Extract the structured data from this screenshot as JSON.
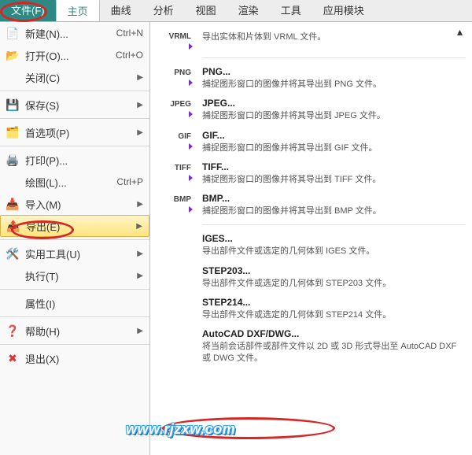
{
  "menubar": {
    "file": "文件(F)",
    "home": "主页",
    "curve": "曲线",
    "analyze": "分析",
    "view": "视图",
    "render": "渲染",
    "tools": "工具",
    "app": "应用模块"
  },
  "left_menu": {
    "new": {
      "label": "新建(N)...",
      "shortcut": "Ctrl+N"
    },
    "open": {
      "label": "打开(O)...",
      "shortcut": "Ctrl+O"
    },
    "close": {
      "label": "关闭(C)"
    },
    "save": {
      "label": "保存(S)"
    },
    "pref": {
      "label": "首选项(P)"
    },
    "print": {
      "label": "打印(P)..."
    },
    "plot": {
      "label": "绘图(L)...",
      "shortcut": "Ctrl+P"
    },
    "import": {
      "label": "导入(M)"
    },
    "export": {
      "label": "导出(E)"
    },
    "util": {
      "label": "实用工具(U)"
    },
    "exec": {
      "label": "执行(T)"
    },
    "prop": {
      "label": "属性(I)"
    },
    "help": {
      "label": "帮助(H)"
    },
    "exit": {
      "label": "退出(X)"
    }
  },
  "sub": {
    "vrml": {
      "tag": "VRML",
      "desc": "导出实体和片体到 VRML 文件。"
    },
    "png": {
      "tag": "PNG",
      "title": "PNG...",
      "desc": "捕捉图形窗口的图像并将其导出到 PNG 文件。"
    },
    "jpeg": {
      "tag": "JPEG",
      "title": "JPEG...",
      "desc": "捕捉图形窗口的图像并将其导出到 JPEG 文件。"
    },
    "gif": {
      "tag": "GIF",
      "title": "GIF...",
      "desc": "捕捉图形窗口的图像并将其导出到 GIF 文件。"
    },
    "tiff": {
      "tag": "TIFF",
      "title": "TIFF...",
      "desc": "捕捉图形窗口的图像并将其导出到 TIFF 文件。"
    },
    "bmp": {
      "tag": "BMP",
      "title": "BMP...",
      "desc": "捕捉图形窗口的图像并将其导出到 BMP 文件。"
    },
    "iges": {
      "title": "IGES...",
      "desc": "导出部件文件或选定的几何体到 IGES 文件。"
    },
    "step203": {
      "title": "STEP203...",
      "desc": "导出部件文件或选定的几何体到 STEP203 文件。"
    },
    "step214": {
      "title": "STEP214...",
      "desc": "导出部件文件或选定的几何体到 STEP214 文件。"
    },
    "dxf": {
      "title": "AutoCAD DXF/DWG...",
      "desc": "将当前会话部件或部件文件以 2D 或 3D 形式导出至 AutoCAD DXF 或 DWG 文件。"
    }
  },
  "watermark": "www.rjzxw.com"
}
